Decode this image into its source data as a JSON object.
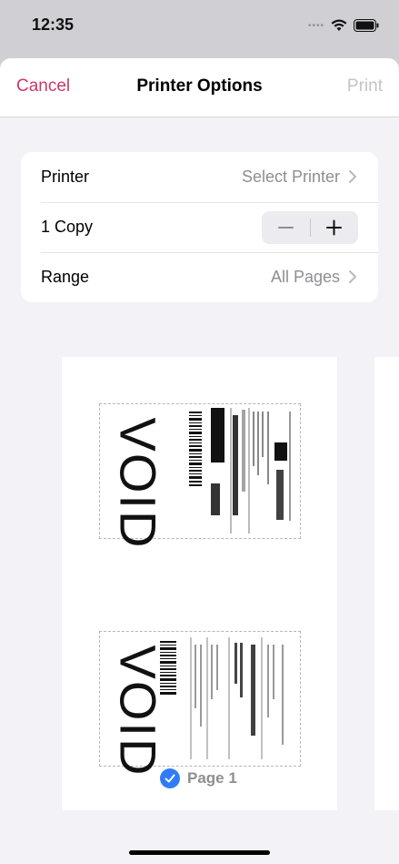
{
  "status_bar": {
    "time": "12:35"
  },
  "nav": {
    "cancel_label": "Cancel",
    "title": "Printer Options",
    "print_label": "Print"
  },
  "options": {
    "printer": {
      "label": "Printer",
      "value": "Select Printer"
    },
    "copies": {
      "label": "1 Copy",
      "minus": "−",
      "plus": "+"
    },
    "range": {
      "label": "Range",
      "value": "All Pages"
    }
  },
  "preview": {
    "void_text_1": "VOID",
    "void_text_2": "VOID",
    "page_label": "Page 1"
  },
  "colors": {
    "accent": "#c9396a",
    "check": "#2f7cf6",
    "disabled": "#c4c4c8"
  },
  "icons": [
    "wifi-icon",
    "battery-icon",
    "chevron-right-icon",
    "checkmark-icon"
  ]
}
